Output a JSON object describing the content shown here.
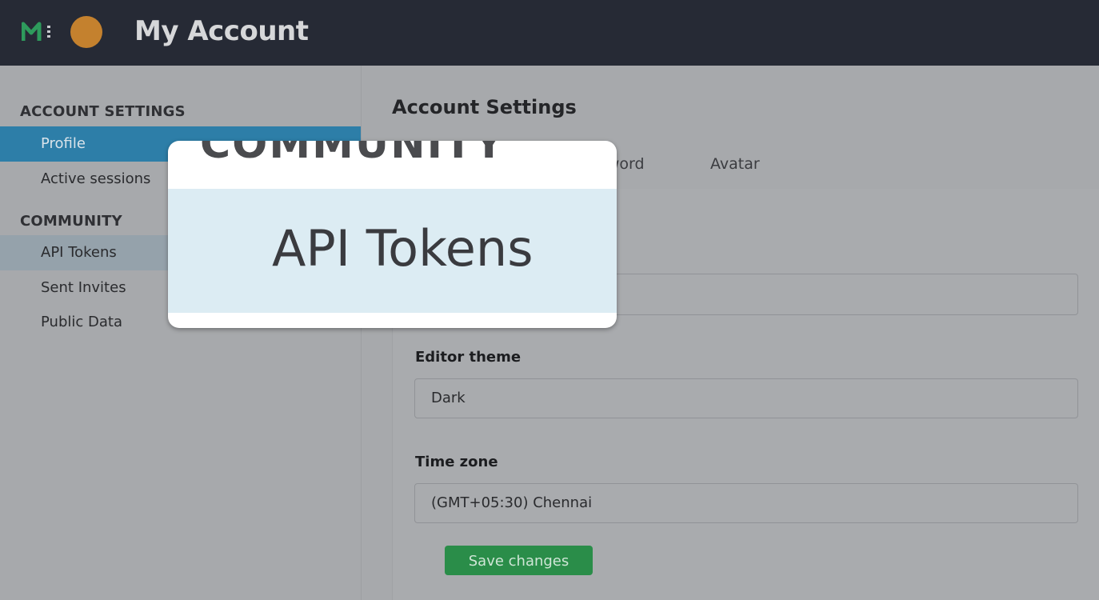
{
  "header": {
    "title": "My Account",
    "logo_icon": "metabase-logo-icon",
    "avatar_color": "#c4812e"
  },
  "sidebar": {
    "account_heading": "ACCOUNT SETTINGS",
    "account_items": [
      {
        "label": "Profile",
        "active": true
      },
      {
        "label": "Active sessions"
      }
    ],
    "community_heading": "COMMUNITY",
    "community_items": [
      {
        "label": "API Tokens",
        "hovered": true
      },
      {
        "label": "Sent Invites"
      },
      {
        "label": "Public Data"
      }
    ]
  },
  "main": {
    "title": "Account Settings",
    "tabs": [
      {
        "label": "Password",
        "visible_text": "ssword"
      },
      {
        "label": "Avatar"
      }
    ],
    "fields": {
      "editor_theme": {
        "label": "Editor theme",
        "value": "Dark"
      },
      "time_zone": {
        "label": "Time zone",
        "value": "(GMT+05:30) Chennai"
      }
    },
    "save_label": "Save changes"
  },
  "zoom": {
    "cut_heading": "COMMUNITY",
    "label": "API Tokens"
  },
  "colors": {
    "header_bg": "#262a35",
    "active_item": "#2d7ea8",
    "save_button": "#2a8d49",
    "zoom_highlight": "#dcecf3"
  }
}
